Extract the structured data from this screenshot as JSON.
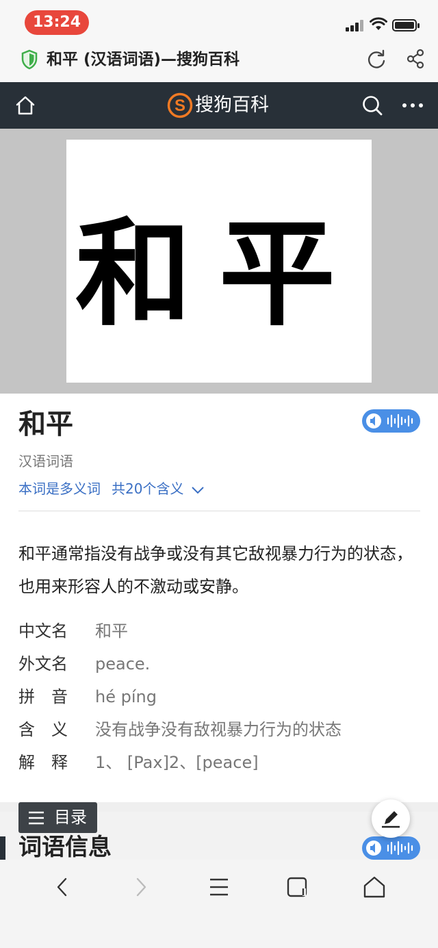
{
  "status": {
    "time": "13:24"
  },
  "browser": {
    "page_title": "和平 (汉语词语)—搜狗百科"
  },
  "site": {
    "brand": "搜狗百科"
  },
  "article": {
    "title": "和平",
    "category": "汉语词语",
    "polysemy_label": "本词是多义词",
    "meanings_count": "共20个含义",
    "description": "和平通常指没有战争或没有其它敌视暴力行为的状态，也用来形容人的不激动或安静。",
    "info": [
      {
        "label": "中文名",
        "value": "和平"
      },
      {
        "label": "外文名",
        "value": "peace."
      },
      {
        "label": "拼　音",
        "value": "hé píng"
      },
      {
        "label": "含　义",
        "value": "没有战争没有敌视暴力行为的状态"
      },
      {
        "label": "解　释",
        "value": "1、 [Pax]2、[peace]"
      }
    ],
    "calligraphy_text": "和平",
    "section_title": "词语信息"
  },
  "toc": {
    "label": "目录"
  },
  "colors": {
    "nav_bg": "#283038",
    "accent_blue": "#4a8fe6",
    "link_blue": "#3a6fc4",
    "time_pill": "#e8473c",
    "logo_orange": "#f07a24"
  },
  "icons": [
    "shield-icon",
    "reload-icon",
    "share-icon",
    "home-icon",
    "sogou-logo-icon",
    "search-icon",
    "more-icon",
    "speaker-icon",
    "menu-icon",
    "edit-icon",
    "chevron-down-icon",
    "back-icon",
    "forward-icon",
    "tabs-menu-icon",
    "window-icon",
    "browser-home-icon"
  ]
}
